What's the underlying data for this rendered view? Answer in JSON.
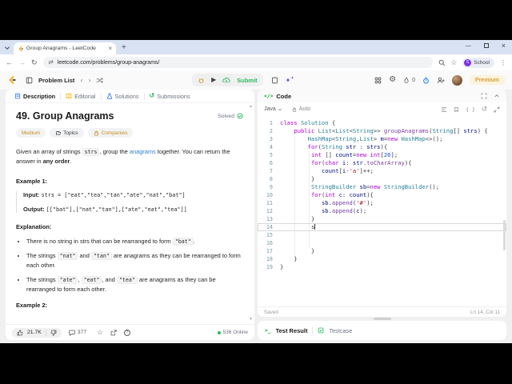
{
  "browser": {
    "tab_title": "Group Anagrams - LeetCode",
    "url": "leetcode.com/problems/group-anagrams/",
    "profile_label": "School"
  },
  "header": {
    "problem_list": "Problem List",
    "submit": "Submit",
    "streak": "0",
    "premium": "Premium"
  },
  "problem": {
    "tabs": [
      "Description",
      "Editorial",
      "Solutions",
      "Submissions"
    ],
    "title": "49. Group Anagrams",
    "solved": "Solved",
    "difficulty": "Medium",
    "topics": "Topics",
    "companies": "Companies",
    "statement": [
      [
        "t",
        "Given an array of strings "
      ],
      [
        "c",
        "strs"
      ],
      [
        "t",
        ", group the "
      ],
      [
        "l",
        "anagrams"
      ],
      [
        "t",
        " together. You can return the answer in "
      ],
      [
        "b",
        "any order"
      ],
      [
        "t",
        "."
      ]
    ],
    "example1_label": "Example 1:",
    "example1_input": [
      [
        "b",
        "Input: "
      ],
      [
        "m",
        "strs = [\"eat\",\"tea\",\"tan\",\"ate\",\"nat\",\"bat\"]"
      ]
    ],
    "example1_output": [
      [
        "b",
        "Output: "
      ],
      [
        "m",
        "[[\"bat\"],[\"nat\",\"tan\"],[\"ate\",\"eat\",\"tea\"]]"
      ]
    ],
    "explanation_label": "Explanation:",
    "bullets": [
      [
        [
          "t",
          "There is no string in strs that can be rearranged to form "
        ],
        [
          "c",
          "\"bat\""
        ],
        [
          "t",
          "."
        ]
      ],
      [
        [
          "t",
          "The strings "
        ],
        [
          "c",
          "\"nat\""
        ],
        [
          "t",
          " and "
        ],
        [
          "c",
          "\"tan\""
        ],
        [
          "t",
          " are anagrams as they can be rearranged to form each other."
        ]
      ],
      [
        [
          "t",
          "The strings "
        ],
        [
          "c",
          "\"ate\""
        ],
        [
          "t",
          ", "
        ],
        [
          "c",
          "\"eat\""
        ],
        [
          "t",
          ", and "
        ],
        [
          "c",
          "\"tea\""
        ],
        [
          "t",
          " are anagrams as they can be rearranged to form each other."
        ]
      ]
    ],
    "example2_label": "Example 2:",
    "likes": "21.7K",
    "comments": "377",
    "online": "536 Online"
  },
  "code_panel": {
    "code_icon": "</>",
    "title": "Code",
    "language": "Java",
    "auto": "Auto",
    "braces_icon": "{ }",
    "reset_icon": "↺",
    "saved": "Saved",
    "cursor_pos": "Ln 14, Col 11",
    "cursor_line": 14,
    "lines": [
      [
        [
          "k",
          "class"
        ],
        [
          "p",
          " "
        ],
        [
          "t",
          "Solution"
        ],
        [
          "p",
          " {"
        ]
      ],
      [
        [
          "p",
          "    "
        ],
        [
          "k",
          "public"
        ],
        [
          "p",
          " "
        ],
        [
          "t",
          "List"
        ],
        [
          "p",
          "<"
        ],
        [
          "t",
          "List"
        ],
        [
          "p",
          "<"
        ],
        [
          "t",
          "String"
        ],
        [
          "p",
          ">> "
        ],
        [
          "f",
          "groupAnagrams"
        ],
        [
          "p",
          "("
        ],
        [
          "t",
          "String"
        ],
        [
          "p",
          "[] "
        ],
        [
          "v",
          "strs"
        ],
        [
          "p",
          ") {"
        ]
      ],
      [
        [
          "p",
          "        "
        ],
        [
          "t",
          "HashMap"
        ],
        [
          "p",
          "<"
        ],
        [
          "t",
          "String"
        ],
        [
          "p",
          ","
        ],
        [
          "t",
          "List"
        ],
        [
          "p",
          "> "
        ],
        [
          "v",
          "m"
        ],
        [
          "p",
          "="
        ],
        [
          "k",
          "new"
        ],
        [
          "p",
          " "
        ],
        [
          "t",
          "HashMap"
        ],
        [
          "p",
          "<>();"
        ]
      ],
      [
        [
          "p",
          "        "
        ],
        [
          "k",
          "for"
        ],
        [
          "p",
          "("
        ],
        [
          "t",
          "String"
        ],
        [
          "p",
          " "
        ],
        [
          "v",
          "str"
        ],
        [
          "p",
          " : "
        ],
        [
          "v",
          "strs"
        ],
        [
          "p",
          "){"
        ]
      ],
      [
        [
          "p",
          "         "
        ],
        [
          "k",
          "int"
        ],
        [
          "p",
          " [] "
        ],
        [
          "v",
          "count"
        ],
        [
          "p",
          "="
        ],
        [
          "k",
          "new"
        ],
        [
          "p",
          " "
        ],
        [
          "k",
          "int"
        ],
        [
          "p",
          "["
        ],
        [
          "n",
          "26"
        ],
        [
          "p",
          "];"
        ]
      ],
      [
        [
          "p",
          "         "
        ],
        [
          "k",
          "for"
        ],
        [
          "p",
          "("
        ],
        [
          "k",
          "char"
        ],
        [
          "p",
          " "
        ],
        [
          "v",
          "i"
        ],
        [
          "p",
          ": "
        ],
        [
          "v",
          "str"
        ],
        [
          "p",
          "."
        ],
        [
          "f",
          "toCharArray"
        ],
        [
          "p",
          "){"
        ]
      ],
      [
        [
          "p",
          "            "
        ],
        [
          "v",
          "count"
        ],
        [
          "p",
          "["
        ],
        [
          "v",
          "i"
        ],
        [
          "p",
          "-"
        ],
        [
          "s",
          "'a'"
        ],
        [
          "p",
          "]++;"
        ]
      ],
      [
        [
          "p",
          "         }"
        ]
      ],
      [
        [
          "p",
          "         "
        ],
        [
          "t",
          "StringBuilder"
        ],
        [
          "p",
          " "
        ],
        [
          "v",
          "sb"
        ],
        [
          "p",
          "="
        ],
        [
          "k",
          "new"
        ],
        [
          "p",
          " "
        ],
        [
          "t",
          "StringBuilder"
        ],
        [
          "p",
          "();"
        ]
      ],
      [
        [
          "p",
          "         "
        ],
        [
          "k",
          "for"
        ],
        [
          "p",
          "("
        ],
        [
          "k",
          "int"
        ],
        [
          "p",
          " "
        ],
        [
          "v",
          "c"
        ],
        [
          "p",
          ": "
        ],
        [
          "v",
          "count"
        ],
        [
          "p",
          "){"
        ]
      ],
      [
        [
          "p",
          "            "
        ],
        [
          "v",
          "sb"
        ],
        [
          "p",
          "."
        ],
        [
          "f",
          "append"
        ],
        [
          "p",
          "("
        ],
        [
          "s",
          "'#'"
        ],
        [
          "p",
          ");"
        ]
      ],
      [
        [
          "p",
          "            "
        ],
        [
          "v",
          "sb"
        ],
        [
          "p",
          "."
        ],
        [
          "f",
          "append"
        ],
        [
          "p",
          "("
        ],
        [
          "v",
          "c"
        ],
        [
          "p",
          ");"
        ]
      ],
      [
        [
          "p",
          "         }"
        ]
      ],
      [
        [
          "p",
          "         s"
        ]
      ],
      [],
      [],
      [
        [
          "p",
          "         }"
        ]
      ],
      [
        [
          "p",
          "    }"
        ]
      ],
      [
        [
          "p",
          "}"
        ]
      ]
    ]
  },
  "console": {
    "prompt_icon": ">_",
    "test_result": "Test Result",
    "testcase": "Testcase"
  }
}
